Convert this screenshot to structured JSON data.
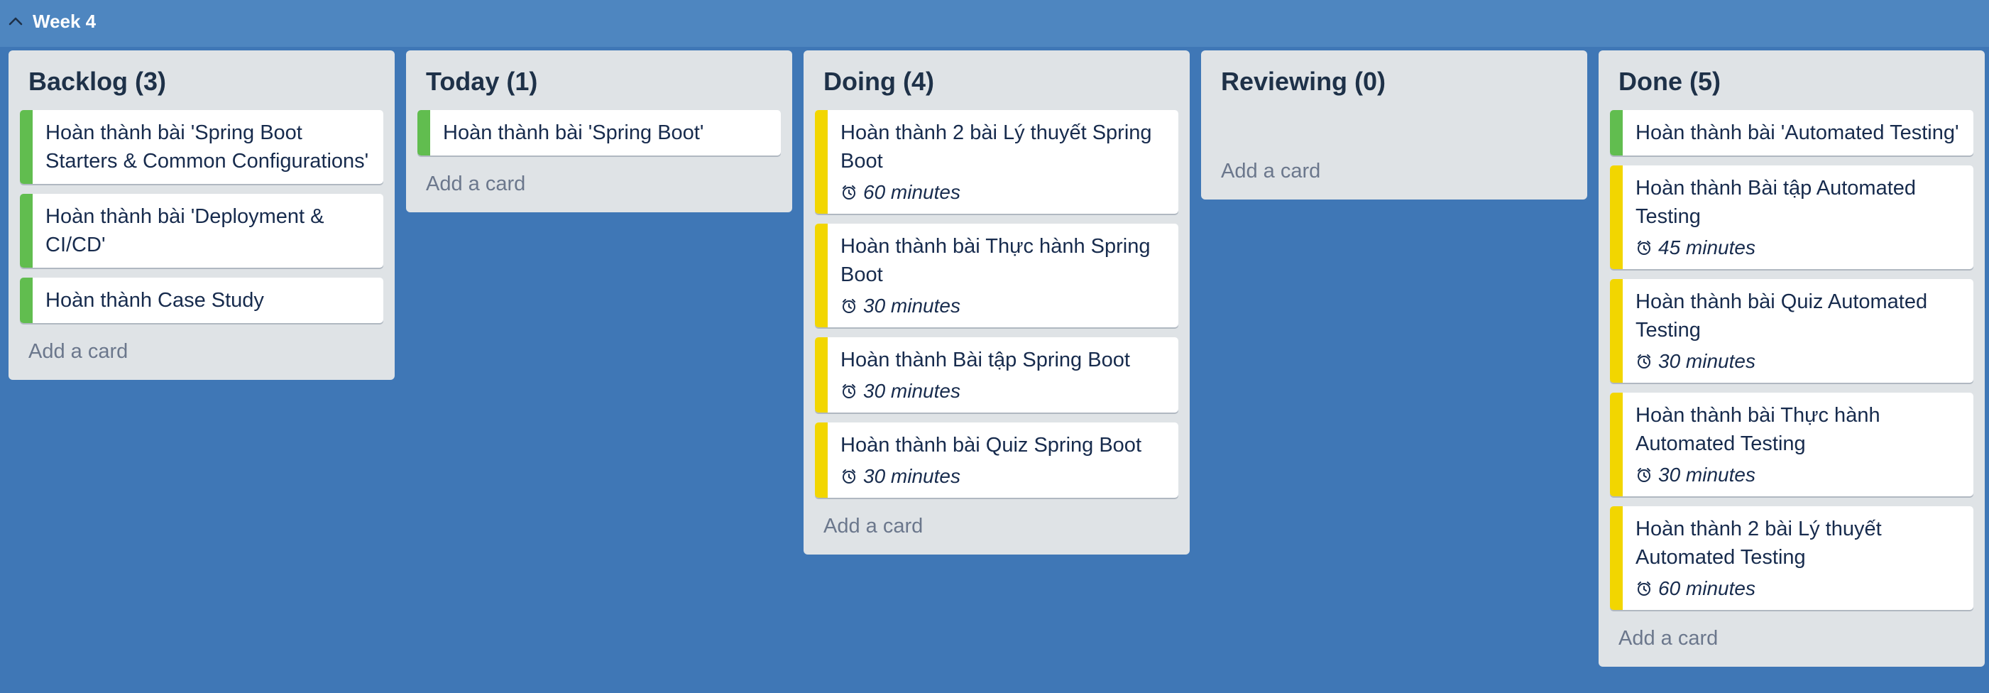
{
  "board": {
    "week_label": "Week 4",
    "colors": {
      "background": "#3f77b6",
      "topbar": "#4e86c0",
      "lane": "#dfe3e6",
      "label_green": "#61bd4f",
      "label_yellow": "#f2d600"
    }
  },
  "lanes": [
    {
      "title": "Backlog (3)",
      "add_card": "Add a card",
      "cards": [
        {
          "title": "Hoàn thành bài 'Spring Boot Starters & Common Configurations'",
          "label": "green"
        },
        {
          "title": "Hoàn thành bài 'Deployment & CI/CD'",
          "label": "green"
        },
        {
          "title": "Hoàn thành Case Study",
          "label": "green"
        }
      ]
    },
    {
      "title": "Today (1)",
      "add_card": "Add a card",
      "cards": [
        {
          "title": "Hoàn thành bài 'Spring Boot'",
          "label": "green"
        }
      ]
    },
    {
      "title": "Doing (4)",
      "add_card": "Add a card",
      "cards": [
        {
          "title": "Hoàn thành 2 bài Lý thuyết Spring Boot",
          "label": "yellow",
          "estimate": "60 minutes",
          "icon": "clock-icon"
        },
        {
          "title": "Hoàn thành bài Thực hành Spring Boot",
          "label": "yellow",
          "estimate": "30 minutes",
          "icon": "clock-icon"
        },
        {
          "title": "Hoàn thành Bài tập Spring Boot",
          "label": "yellow",
          "estimate": "30 minutes",
          "icon": "clock-icon"
        },
        {
          "title": "Hoàn thành bài Quiz Spring Boot",
          "label": "yellow",
          "estimate": "30 minutes",
          "icon": "clock-icon"
        }
      ]
    },
    {
      "title": "Reviewing (0)",
      "add_card": "Add a card",
      "cards": []
    },
    {
      "title": "Done (5)",
      "add_card": "Add a card",
      "cards": [
        {
          "title": "Hoàn thành bài 'Automated Testing'",
          "label": "green"
        },
        {
          "title": "Hoàn thành Bài tập Automated Testing",
          "label": "yellow",
          "estimate": "45 minutes",
          "icon": "clock-icon"
        },
        {
          "title": "Hoàn thành bài Quiz Automated Testing",
          "label": "yellow",
          "estimate": "30 minutes",
          "icon": "clock-icon"
        },
        {
          "title": "Hoàn thành bài Thực hành Automated Testing",
          "label": "yellow",
          "estimate": "30 minutes",
          "icon": "clock-icon"
        },
        {
          "title": "Hoàn thành 2 bài Lý thuyết Automated Testing",
          "label": "yellow",
          "estimate": "60 minutes",
          "icon": "clock-icon"
        }
      ]
    }
  ]
}
